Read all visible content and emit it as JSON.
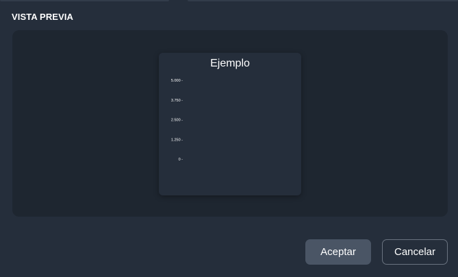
{
  "section": {
    "title": "VISTA PREVIA"
  },
  "chart_data": {
    "type": "bar",
    "title": "Ejemplo",
    "xlabel": "",
    "ylabel": "",
    "y_ticks": [
      "5.000 -",
      "3.750 -",
      "2.500 -",
      "1.250 -",
      "0 -"
    ],
    "ylim": [
      0,
      5000
    ],
    "categories": [],
    "values": [],
    "grid": false
  },
  "buttons": {
    "accept": "Aceptar",
    "cancel": "Cancelar"
  },
  "colors": {
    "background": "#252e3b",
    "preview_area": "#1e2630",
    "accent_button": "#4a5565"
  }
}
